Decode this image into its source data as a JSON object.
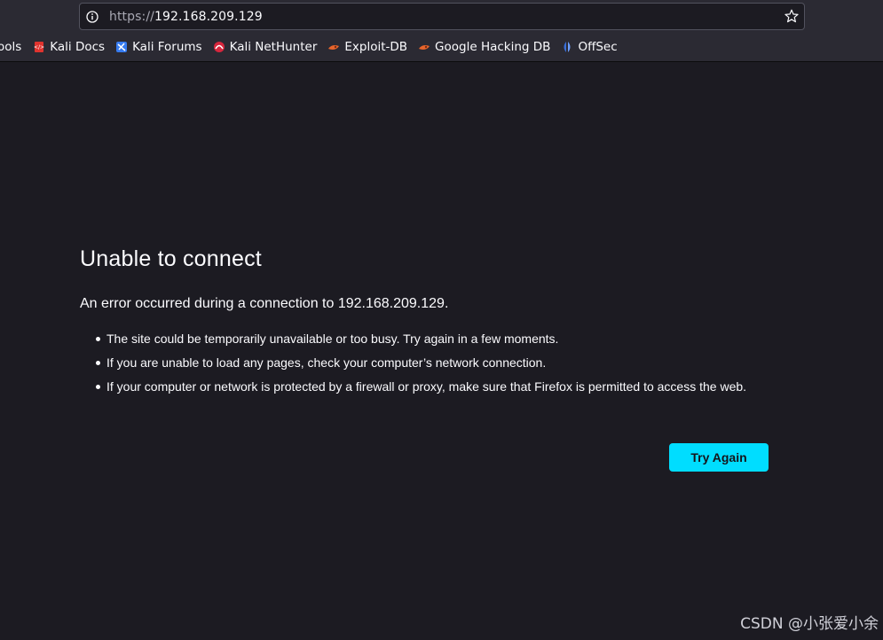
{
  "urlbar": {
    "protocol": "https://",
    "host": "192.168.209.129"
  },
  "bookmarks": [
    {
      "label": "Tools",
      "icon": "none"
    },
    {
      "label": "Kali Docs",
      "icon": "kali-docs-icon"
    },
    {
      "label": "Kali Forums",
      "icon": "kali-forums-icon"
    },
    {
      "label": "Kali NetHunter",
      "icon": "kali-nethunter-icon"
    },
    {
      "label": "Exploit-DB",
      "icon": "exploit-db-icon"
    },
    {
      "label": "Google Hacking DB",
      "icon": "ghdb-icon"
    },
    {
      "label": "OffSec",
      "icon": "offsec-icon"
    }
  ],
  "error": {
    "title": "Unable to connect",
    "message": "An error occurred during a connection to 192.168.209.129.",
    "bullets": [
      "The site could be temporarily unavailable or too busy. Try again in a few moments.",
      "If you are unable to load any pages, check your computer’s network connection.",
      "If your computer or network is protected by a firewall or proxy, make sure that Firefox is permitted to access the web."
    ],
    "button_label": "Try Again"
  },
  "watermark": "CSDN @小张爱小余",
  "colors": {
    "background": "#1c1b22",
    "toolbar": "#2b2a33",
    "accent_button": "#00ddff"
  }
}
